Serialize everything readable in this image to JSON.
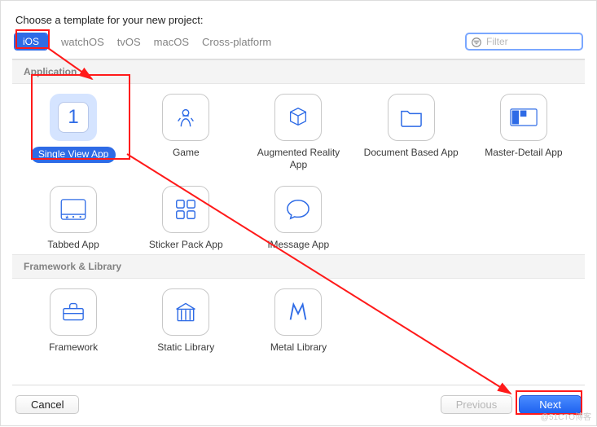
{
  "prompt": "Choose a template for your new project:",
  "platforms": {
    "ios": "iOS",
    "watchos": "watchOS",
    "tvos": "tvOS",
    "macos": "macOS",
    "cross": "Cross-platform"
  },
  "search": {
    "placeholder": "Filter"
  },
  "sections": {
    "app": "Application",
    "fwk": "Framework & Library"
  },
  "templates": {
    "app": {
      "single_view": {
        "label": "Single View App",
        "digit": "1"
      },
      "game": {
        "label": "Game"
      },
      "ar": {
        "label": "Augmented Reality App"
      },
      "doc": {
        "label": "Document Based App"
      },
      "master_detail": {
        "label": "Master-Detail App"
      },
      "tabbed": {
        "label": "Tabbed App"
      },
      "sticker": {
        "label": "Sticker Pack App"
      },
      "imessage": {
        "label": "iMessage App"
      }
    },
    "fwk": {
      "framework": {
        "label": "Framework"
      },
      "static": {
        "label": "Static Library"
      },
      "metal": {
        "label": "Metal Library"
      }
    }
  },
  "buttons": {
    "cancel": "Cancel",
    "previous": "Previous",
    "next": "Next"
  },
  "colors": {
    "accent": "#2e6be6",
    "annotation": "#ff1a1a"
  },
  "watermark": "@51CTO博客"
}
